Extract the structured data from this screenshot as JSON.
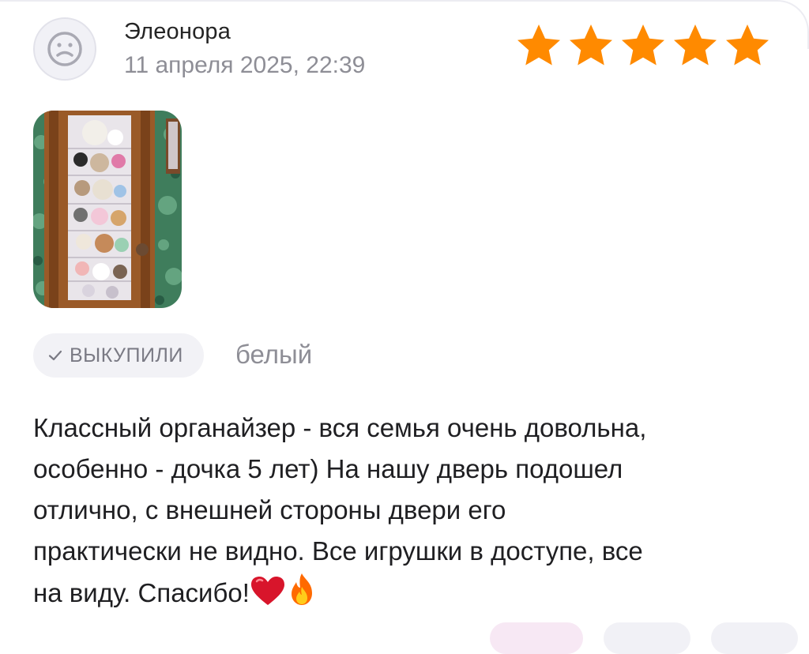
{
  "review": {
    "author": "Элеонора",
    "date": "11 апреля 2025, 22:39",
    "rating": 5,
    "rating_max": 5,
    "star_color": "#ff8a00",
    "status_badge": "ВЫКУПИЛИ",
    "variant": "белый",
    "text_main": "Классный органайзер - вся семья очень довольна,\nособенно - дочка 5 лет) На нашу дверь подошел\nотлично, с внешней стороны двери его\nпрактически не видно. Все игрушки в доступе, все\nна виду. Спасибо!"
  },
  "icons": {
    "avatar": "sad-face-icon",
    "badge": "check-icon",
    "heart": "red-heart-emoji",
    "fire": "fire-emoji"
  }
}
